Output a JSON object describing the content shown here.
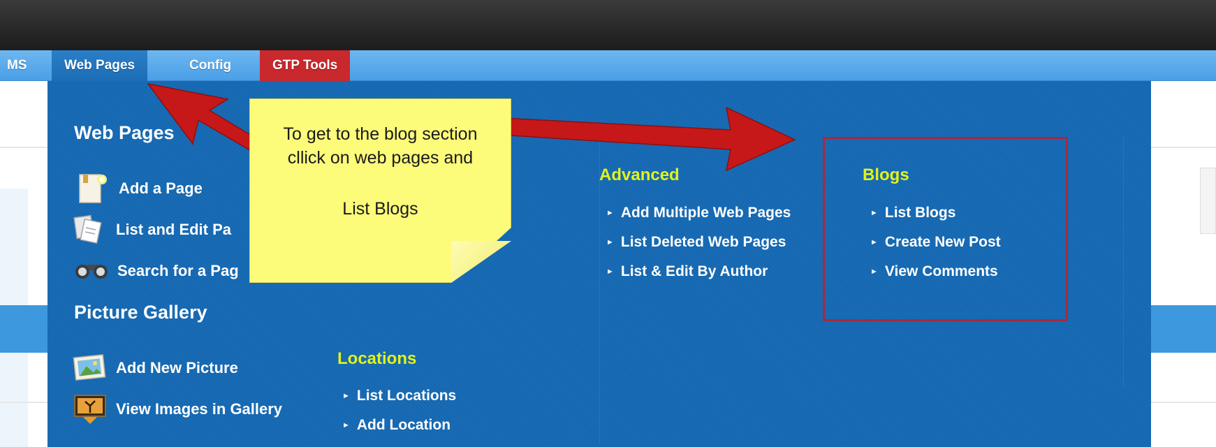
{
  "nav": {
    "items": [
      {
        "label": "MS"
      },
      {
        "label": "Web Pages"
      },
      {
        "label": "Config"
      },
      {
        "label": "GTP Tools"
      }
    ]
  },
  "menu": {
    "web_pages": {
      "title": "Web Pages",
      "items": [
        {
          "label": "Add a Page",
          "icon": "page-add-icon"
        },
        {
          "label": "List and Edit Pa",
          "icon": "pages-list-icon"
        },
        {
          "label": "Search for a Pag",
          "icon": "binoculars-icon"
        }
      ]
    },
    "picture_gallery": {
      "title": "Picture Gallery",
      "items": [
        {
          "label": "Add New Picture",
          "icon": "picture-add-icon"
        },
        {
          "label": "View Images in Gallery",
          "icon": "gallery-view-icon"
        }
      ]
    },
    "locations": {
      "title": "Locations",
      "items": [
        {
          "label": "List Locations"
        },
        {
          "label": "Add Location"
        }
      ]
    },
    "advanced": {
      "title": "Advanced",
      "items": [
        {
          "label": "Add Multiple Web Pages"
        },
        {
          "label": "List Deleted Web Pages"
        },
        {
          "label": "List & Edit By Author"
        }
      ]
    },
    "blogs": {
      "title": "Blogs",
      "items": [
        {
          "label": "List Blogs"
        },
        {
          "label": "Create New Post"
        },
        {
          "label": "View Comments"
        }
      ]
    }
  },
  "note": {
    "line1": "To get to the blog section",
    "line2": "cllick on web pages and",
    "line3": "List Blogs"
  },
  "colors": {
    "panel": "#1469b3",
    "subheading": "#e3f21a",
    "tools_tab": "#c9282d",
    "arrow": "#c61818",
    "highlight": "#a62a3e",
    "note": "#fdfb7a"
  }
}
